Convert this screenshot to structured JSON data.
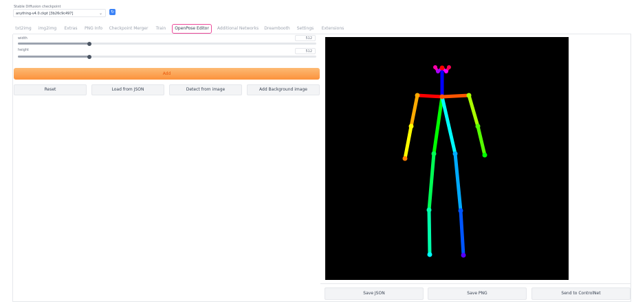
{
  "checkpoint": {
    "label": "Stable Diffusion checkpoint",
    "value": "anything-v4.0.ckpt [3b26c9c497]"
  },
  "icons": {
    "refresh": "refresh-icon",
    "chevron": "chevron-down-icon"
  },
  "tabs": [
    {
      "label": "txt2img"
    },
    {
      "label": "img2img"
    },
    {
      "label": "Extras"
    },
    {
      "label": "PNG Info"
    },
    {
      "label": "Checkpoint Merger"
    },
    {
      "label": "Train"
    },
    {
      "label": "OpenPose Editor",
      "active": true
    },
    {
      "label": "Additional Networks"
    },
    {
      "label": "Dreambooth"
    },
    {
      "label": "Settings"
    },
    {
      "label": "Extensions"
    }
  ],
  "width": {
    "label": "width",
    "value": "512",
    "level": 0.24
  },
  "height": {
    "label": "height",
    "value": "512",
    "level": 0.24
  },
  "buttons": {
    "add": "Add",
    "reset": "Reset",
    "load_json": "Load from JSON",
    "detect": "Detect from image",
    "add_bg": "Add Background image",
    "save_json": "Save JSON",
    "save_png": "Save PNG",
    "send": "Send to ControlNet"
  },
  "colors": {
    "accent": "#fb923c",
    "active_tab_border": "#ec4899",
    "canvas_bg": "#000000"
  }
}
